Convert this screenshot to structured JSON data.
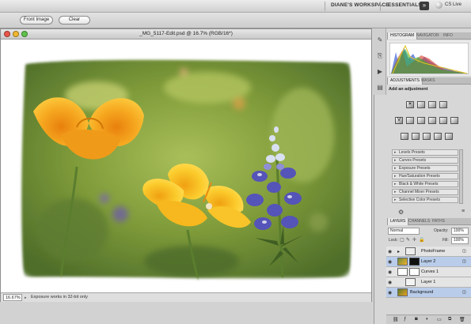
{
  "appbar": {
    "workspace_label": "DIANE'S WORKSPACE",
    "essentials_label": "ESSENTIALS",
    "more_label": "»",
    "cslive_label": "CS Live"
  },
  "options_bar": {
    "front_image_label": "Front Image",
    "clear_label": "Clear"
  },
  "document": {
    "title": "_MG_5117-Edit.psd @ 16.7% (RGB/16*)",
    "zoom": "16.67%",
    "status_message": "Exposure works in 32-bit only"
  },
  "panels": {
    "top_tabs": [
      "HISTOGRAM",
      "NAVIGATOR",
      "INFO"
    ],
    "adjust_tabs": [
      "ADJUSTMENTS",
      "MASKS"
    ],
    "add_adjustment_label": "Add an adjustment",
    "presets": [
      "Levels Presets",
      "Curves Presets",
      "Exposure Presets",
      "Hue/Saturation Presets",
      "Black & White Presets",
      "Channel Mixer Presets",
      "Selective Color Presets"
    ],
    "layer_tabs": [
      "LAYERS",
      "CHANNELS",
      "PATHS"
    ],
    "blend_mode": "Normal",
    "opacity_label": "Opacity:",
    "opacity_value": "100%",
    "lock_label": "Lock:",
    "fill_label": "Fill:",
    "fill_value": "100%",
    "layers": [
      {
        "name": "PhotoFrame",
        "selected": false
      },
      {
        "name": "Layer 2",
        "selected": true
      },
      {
        "name": "Curves 1",
        "selected": false
      },
      {
        "name": "Layer 1",
        "selected": false
      },
      {
        "name": "Background",
        "selected": true
      }
    ]
  },
  "colors": {
    "panel_bg": "#d7d7d7",
    "selection": "#b9cdea",
    "red_light": "#e9554a",
    "yellow_light": "#f1b730",
    "green_light": "#5fc24b"
  }
}
